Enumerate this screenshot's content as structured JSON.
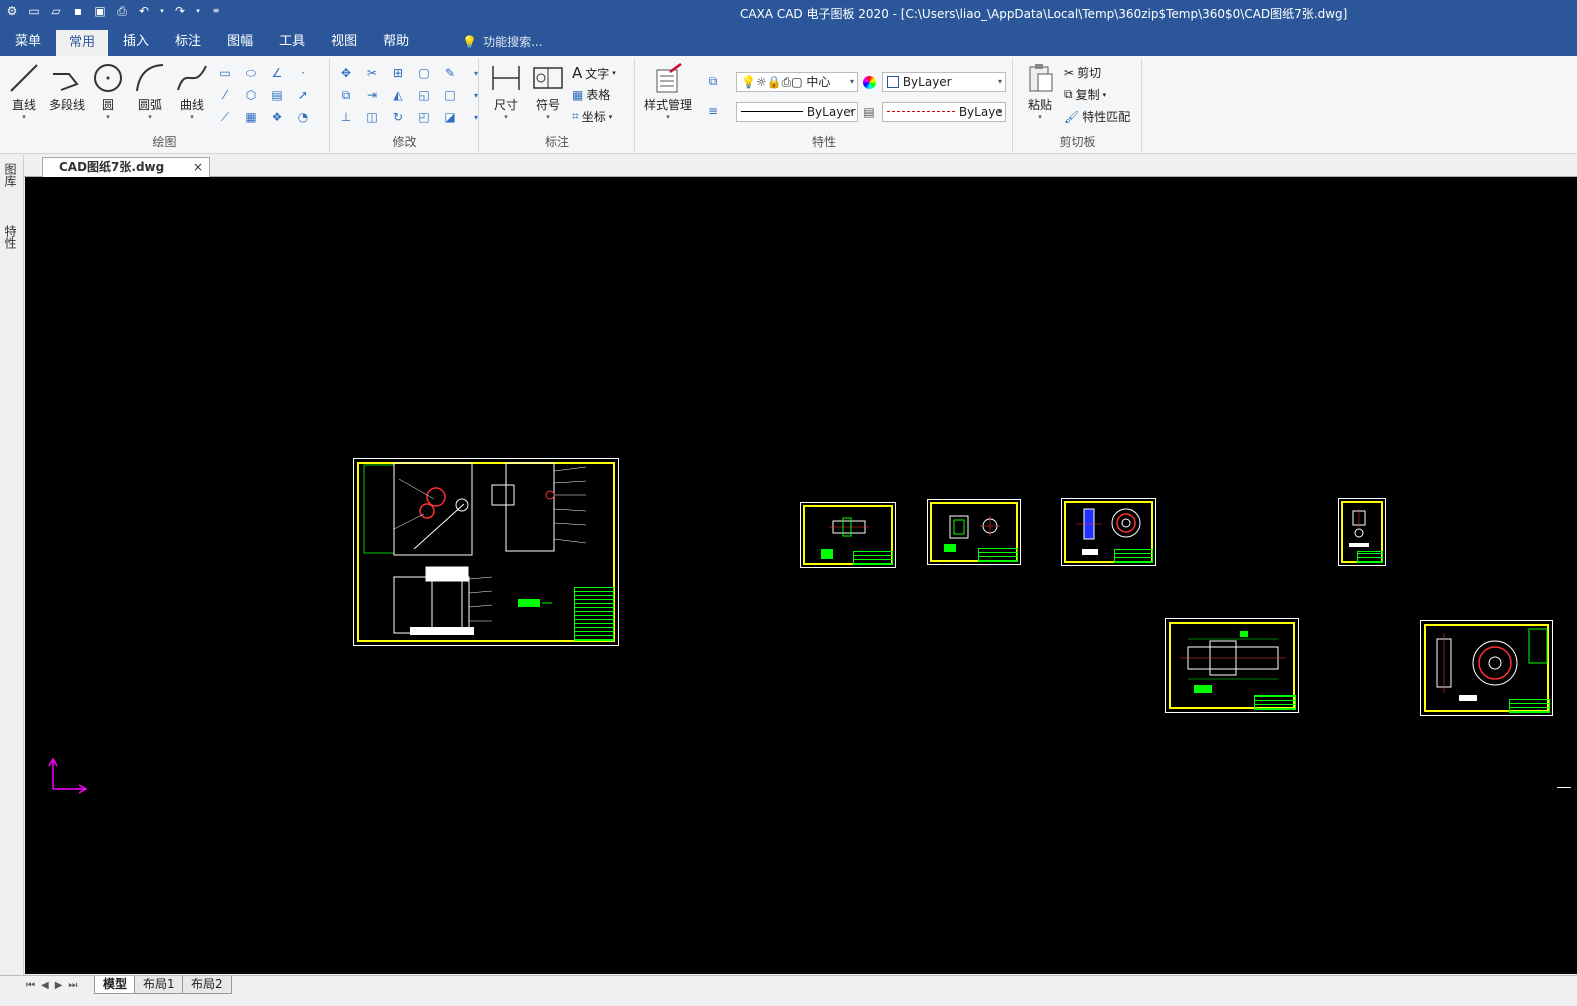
{
  "app": {
    "title": "CAXA CAD 电子图板 2020 - [C:\\Users\\liao_\\AppData\\Local\\Temp\\360zip$Temp\\360$0\\CAD图纸7张.dwg]"
  },
  "menu": {
    "tabs": [
      "菜单",
      "常用",
      "插入",
      "标注",
      "图幅",
      "工具",
      "视图",
      "帮助"
    ],
    "active": "常用",
    "search_label": "功能搜索..."
  },
  "ribbon": {
    "draw": {
      "title": "绘图",
      "line": "直线",
      "polyline": "多段线",
      "circle": "圆",
      "arc": "圆弧",
      "curve": "曲线"
    },
    "modify": {
      "title": "修改"
    },
    "annotate": {
      "title": "标注",
      "dimension": "尺寸",
      "symbol": "符号",
      "text": "文字",
      "table": "表格",
      "coordinate": "坐标"
    },
    "properties": {
      "title": "特性",
      "style_manager": "样式管理",
      "layer_value": "中心",
      "color_value": "ByLayer",
      "linetype_value": "ByLayer",
      "lineweight_value": "ByLaye"
    },
    "clipboard": {
      "title": "剪切板",
      "paste": "粘贴",
      "cut": "剪切",
      "copy": "复制",
      "match": "特性匹配"
    }
  },
  "side_panels": [
    "图库",
    "特性"
  ],
  "document": {
    "tab_label": "CAD图纸7张.dwg",
    "close": "×"
  },
  "layouts": {
    "tabs": [
      "模型",
      "布局1",
      "布局2"
    ],
    "active": "模型"
  },
  "colors": {
    "titlebar": "#2b579a",
    "canvas": "#000000",
    "frame": "#ffff00",
    "titleblock": "#00ff00",
    "ucs": "#ff00ff"
  }
}
